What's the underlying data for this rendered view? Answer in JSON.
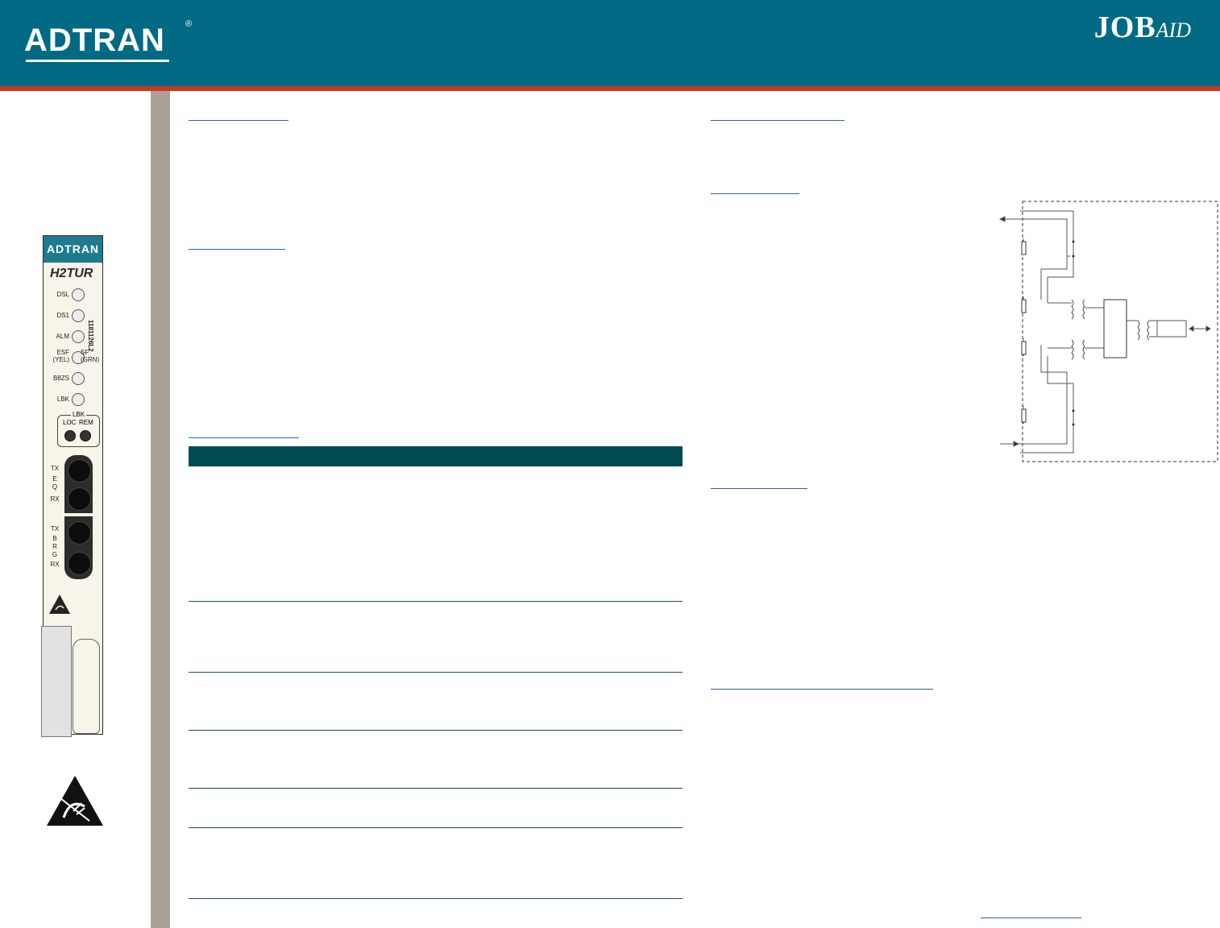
{
  "header": {
    "brand": "ADTRAN",
    "brand_mark": "®",
    "doc_type_job": "JOB",
    "doc_type_aid": "AID"
  },
  "card": {
    "logo": "ADTRAN",
    "model": "H2TUR",
    "part_number": "1181126L2",
    "leds": [
      {
        "label": "DSL"
      },
      {
        "label": "DS1"
      },
      {
        "label": "ALM"
      },
      {
        "label": "ESF\n(YEL)",
        "right_label": "SF\n(GRN)"
      },
      {
        "label": "B8ZS"
      },
      {
        "label": "LBK"
      }
    ],
    "lbk_box": {
      "title": "LBK",
      "loc": "LOC",
      "rem": "REM"
    },
    "jacks": {
      "eq": {
        "tx": "TX",
        "mid": "E\nQ",
        "rx": "RX"
      },
      "brg": {
        "tx": "TX",
        "mid": "B\nR\nG",
        "rx": "RX"
      }
    }
  },
  "colors": {
    "header_bg": "#006a85",
    "header_accent": "#c73a1f",
    "side_bar": "#aba296",
    "table_header": "#014b53",
    "link_rule": "#2c5fb0"
  },
  "icons": [
    "esd-warning-icon",
    "schematic-diagram"
  ]
}
